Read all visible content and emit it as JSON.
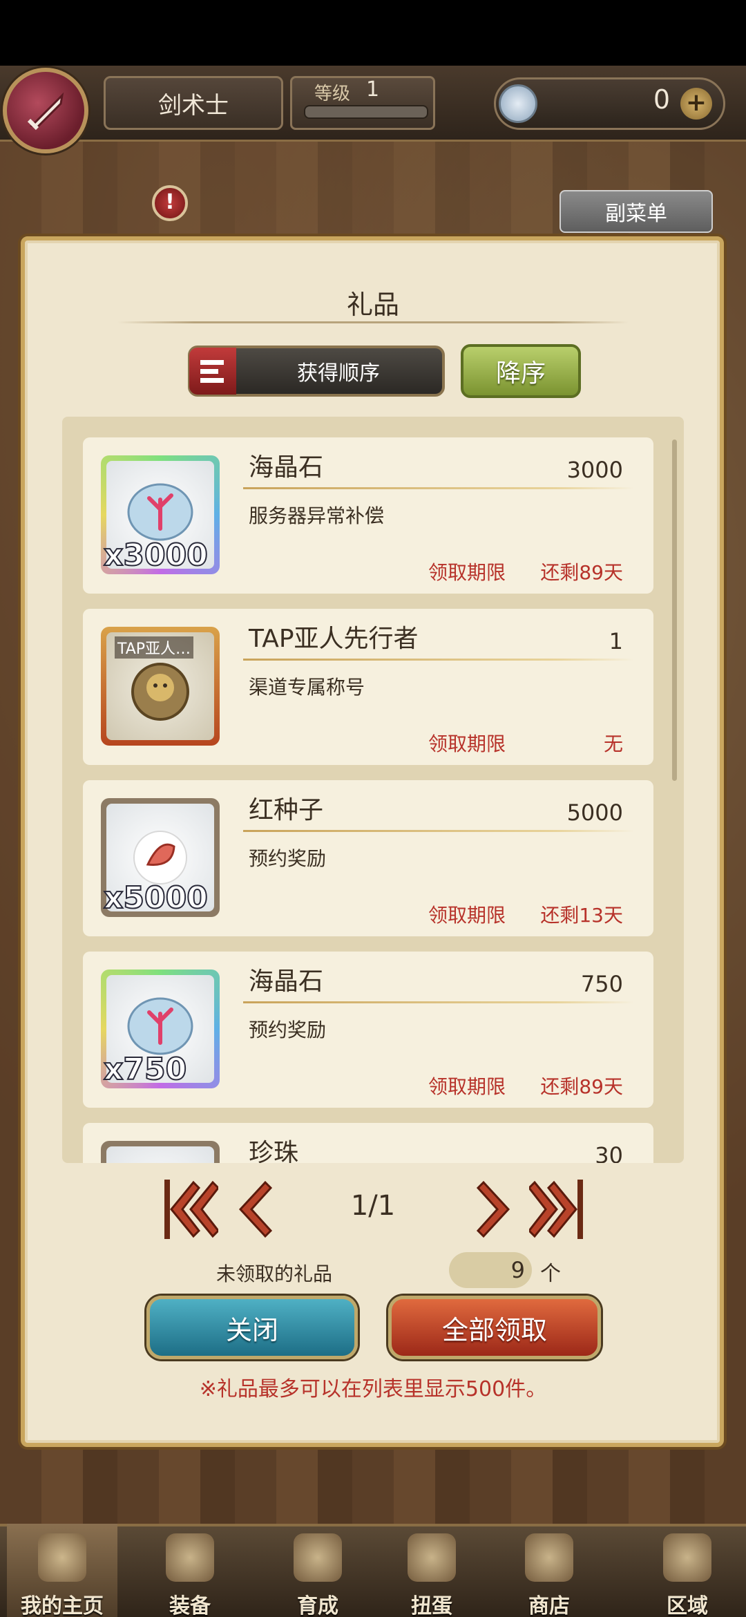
{
  "header": {
    "class_name": "剑术士",
    "level_label": "等级",
    "level_value": "1",
    "gem_count": "0"
  },
  "sub_menu_label": "副菜单",
  "panel": {
    "title": "礼品",
    "sort_label": "获得顺序",
    "order_label": "降序"
  },
  "items": [
    {
      "name": "海晶石",
      "count": "3000",
      "desc": "服务器异常补偿",
      "qty": "x3000",
      "limit_label": "领取期限",
      "limit_value": "还剩89天",
      "thumb": "sea-crystal-icon"
    },
    {
      "name": "TAP亚人先行者",
      "count": "1",
      "desc": "渠道专属称号",
      "qty": "",
      "badge": "TAP亚人…",
      "limit_label": "领取期限",
      "limit_value": "无",
      "thumb": "title-medal-icon"
    },
    {
      "name": "红种子",
      "count": "5000",
      "desc": "预约奖励",
      "qty": "x5000",
      "limit_label": "领取期限",
      "limit_value": "还剩13天",
      "thumb": "red-seed-icon"
    },
    {
      "name": "海晶石",
      "count": "750",
      "desc": "预约奖励",
      "qty": "x750",
      "limit_label": "领取期限",
      "limit_value": "还剩89天",
      "thumb": "sea-crystal-icon"
    },
    {
      "name": "珍珠",
      "count": "30",
      "thumb": "pearl-icon"
    }
  ],
  "pager": {
    "indicator": "1/1"
  },
  "unclaimed": {
    "label": "未领取的礼品",
    "value": "9",
    "unit": "个"
  },
  "buttons": {
    "close": "关闭",
    "claim_all": "全部领取"
  },
  "notice": "※礼品最多可以在列表里显示500件。",
  "nav": [
    {
      "label": "我的主页",
      "icon": "home-scroll-icon"
    },
    {
      "label": "装备",
      "icon": "helmet-icon"
    },
    {
      "label": "育成",
      "icon": "swords-icon"
    },
    {
      "label": "扭蛋",
      "icon": "gacha-icon"
    },
    {
      "label": "商店",
      "icon": "shop-bag-icon"
    },
    {
      "label": "区域",
      "icon": "globe-icon"
    }
  ],
  "colors": {
    "accent_red": "#b7322a",
    "panel_bg": "#efe6cf",
    "order_btn": "#9bb24a"
  }
}
